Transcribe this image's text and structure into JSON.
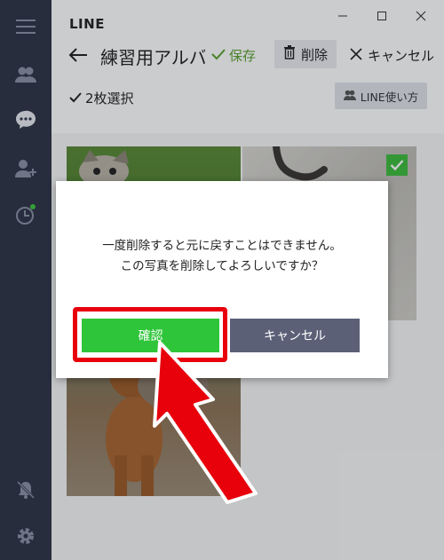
{
  "app": {
    "name": "LINE"
  },
  "toolbar": {
    "album_title": "練習用アルバム",
    "save_label": "保存",
    "delete_label": "削除",
    "cancel_label": "キャンセル"
  },
  "selection": {
    "count_label": "2枚選択"
  },
  "help_label": "LINE使い方",
  "dialog": {
    "line1": "一度削除すると元に戻すことはできません。",
    "line2": "この写真を削除してよろしいですか？",
    "confirm_label": "確認",
    "cancel_label": "キャンセル"
  },
  "colors": {
    "sidebar": "#2e3446",
    "accent_green": "#2fc53a",
    "cancel_gray": "#5b6077",
    "annotation_red": "#e8000b"
  },
  "icons": [
    "menu-icon",
    "friends-icon",
    "chat-icon",
    "add-friend-icon",
    "timeline-icon",
    "mute-bell-icon",
    "settings-icon",
    "minimize-icon",
    "maximize-icon",
    "close-icon",
    "back-arrow-icon",
    "check-icon",
    "trash-icon",
    "x-icon",
    "people-icon"
  ]
}
